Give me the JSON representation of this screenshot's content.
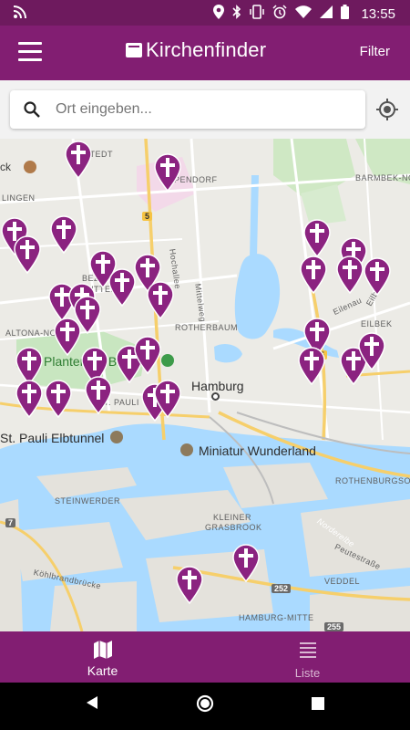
{
  "status_bar": {
    "time": "13:55",
    "icons": [
      "wifi-calling-icon",
      "location-icon",
      "bluetooth-icon",
      "vibrate-icon",
      "alarm-icon",
      "wifi-icon",
      "signal-icon",
      "battery-icon"
    ]
  },
  "app_bar": {
    "title": "Kirchenfinder",
    "menu_icon": "hamburger-menu-icon",
    "filter_label": "Filter"
  },
  "search": {
    "placeholder": "Ort eingeben...",
    "value": "",
    "search_icon": "search-icon",
    "locate_icon": "my-location-icon"
  },
  "map": {
    "place_labels": [
      {
        "text": "STEDT",
        "cls": "lbl-small"
      },
      {
        "text": "EPPENDORF",
        "cls": "lbl-small"
      },
      {
        "text": "BARMBEK-NORD",
        "cls": "lbl-small"
      },
      {
        "text": "ck",
        "cls": "lbl-mid"
      },
      {
        "text": "LINGEN",
        "cls": "lbl-small"
      },
      {
        "text": "Hochallee",
        "cls": "lbl-small"
      },
      {
        "text": "Mittelweg",
        "cls": "lbl-small"
      },
      {
        "text": "BEZIRK",
        "cls": "lbl-small"
      },
      {
        "text": "UTTEL",
        "cls": "lbl-small"
      },
      {
        "text": "ALTONA-NO",
        "cls": "lbl-small"
      },
      {
        "text": "ROTHERBAUM",
        "cls": "lbl-small"
      },
      {
        "text": "EILBEK",
        "cls": "lbl-small"
      },
      {
        "text": "Eilbektal",
        "cls": "lbl-small"
      },
      {
        "text": "Eilenau",
        "cls": "lbl-small"
      },
      {
        "text": "Planten un Blomen",
        "cls": "lbl-park"
      },
      {
        "text": "Hamburg",
        "cls": "lbl-big"
      },
      {
        "text": "T. PAULI",
        "cls": "lbl-small"
      },
      {
        "text": "St. Pauli Elbtunnel",
        "cls": "lbl-big"
      },
      {
        "text": "Miniatur Wunderland",
        "cls": "lbl-big"
      },
      {
        "text": "ROTHENBURGSORT",
        "cls": "lbl-small"
      },
      {
        "text": "STEINWERDER",
        "cls": "lbl-small"
      },
      {
        "text": "KLEINER",
        "cls": "lbl-small"
      },
      {
        "text": "GRASBROOK",
        "cls": "lbl-small"
      },
      {
        "text": "Norderelbe",
        "cls": "lbl-water"
      },
      {
        "text": "Peutestraße",
        "cls": "lbl-small"
      },
      {
        "text": "Köhlbrandbrücke",
        "cls": "lbl-small"
      },
      {
        "text": "VEDDEL",
        "cls": "lbl-small"
      },
      {
        "text": "HAMBURG-MITTE",
        "cls": "lbl-small"
      }
    ],
    "route_badges": [
      {
        "text": "5",
        "style": "y"
      },
      {
        "text": "5",
        "style": "y"
      },
      {
        "text": "7",
        "style": "g"
      },
      {
        "text": "252",
        "style": "g"
      },
      {
        "text": "255",
        "style": "g"
      }
    ],
    "church_marker_icon": "church-cross-marker-icon",
    "church_marker_count": 39
  },
  "bottom_nav": {
    "tabs": [
      {
        "label": "Karte",
        "icon": "map-icon",
        "active": true
      },
      {
        "label": "Liste",
        "icon": "list-icon",
        "active": false
      }
    ]
  },
  "system_nav": {
    "buttons": [
      "back-icon",
      "home-icon",
      "recent-apps-icon"
    ]
  },
  "colors": {
    "primary": "#821e72",
    "status_bar": "#6e1a5e",
    "marker": "#8b2380",
    "water": "#aadaff",
    "park": "#c8e6c0"
  }
}
